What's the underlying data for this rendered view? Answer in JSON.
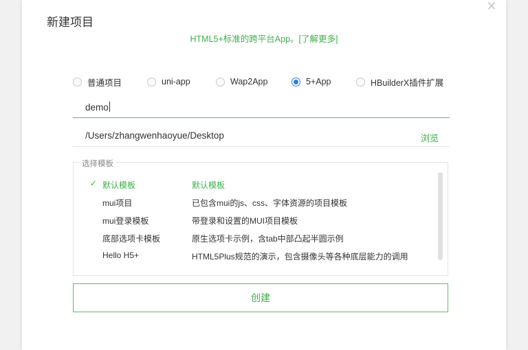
{
  "dialog": {
    "title": "新建项目",
    "close_icon": "close-icon",
    "subtitle_text": "HTML5+标准的跨平台App。",
    "subtitle_link": "[了解更多]"
  },
  "project_types": [
    {
      "label": "普通项目",
      "checked": false
    },
    {
      "label": "uni-app",
      "checked": false
    },
    {
      "label": "Wap2App",
      "checked": false
    },
    {
      "label": "5+App",
      "checked": true
    },
    {
      "label": "HBuilderX插件扩展",
      "checked": false
    }
  ],
  "name_field": {
    "value": "demo"
  },
  "path_field": {
    "value": "/Users/zhangwenhaoyue/Desktop",
    "browse_label": "浏览"
  },
  "templates": {
    "legend": "选择模板",
    "rows": [
      {
        "name": "默认模板",
        "desc": "默认模板",
        "selected": true
      },
      {
        "name": "mui项目",
        "desc": "已包含mui的js、css、字体资源的项目模板",
        "selected": false
      },
      {
        "name": "mui登录模板",
        "desc": "带登录和设置的MUI项目模板",
        "selected": false
      },
      {
        "name": "底部选项卡模板",
        "desc": "原生选项卡示例，含tab中部凸起半圆示例",
        "selected": false
      },
      {
        "name": "Hello H5+",
        "desc": "HTML5Plus规范的演示，包含摄像头等各种底层能力的调用",
        "selected": false
      }
    ]
  },
  "create_button": {
    "label": "创建"
  },
  "colors": {
    "accent_green": "#3eaf4b",
    "radio_blue": "#2f7de1"
  }
}
